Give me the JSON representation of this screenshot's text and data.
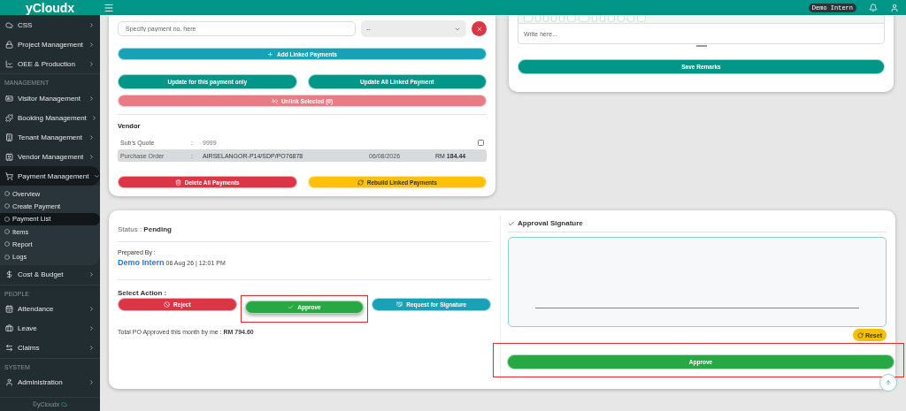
{
  "sidebar": {
    "brand": "yCloudx",
    "items": [
      {
        "kind": "item",
        "label": "CSS"
      },
      {
        "kind": "item",
        "label": "Project Management"
      },
      {
        "kind": "item",
        "label": "OEE & Production"
      },
      {
        "kind": "section",
        "label": "MANAGEMENT"
      },
      {
        "kind": "item",
        "label": "Visitor Management"
      },
      {
        "kind": "item",
        "label": "Booking Management"
      },
      {
        "kind": "item",
        "label": "Tenant Management"
      },
      {
        "kind": "item",
        "label": "Vendor Management"
      },
      {
        "kind": "item",
        "label": "Payment Management",
        "expanded": true,
        "children": [
          {
            "label": "Overview",
            "selected": false
          },
          {
            "label": "Create Payment",
            "selected": false
          },
          {
            "label": "Payment List",
            "selected": true
          },
          {
            "label": "Items",
            "selected": false
          },
          {
            "label": "Report",
            "selected": false
          },
          {
            "label": "Logs",
            "selected": false
          }
        ]
      },
      {
        "kind": "item",
        "label": "Cost & Budget"
      },
      {
        "kind": "section",
        "label": "PEOPLE"
      },
      {
        "kind": "item",
        "label": "Attendance"
      },
      {
        "kind": "item",
        "label": "Leave"
      },
      {
        "kind": "item",
        "label": "Claims"
      },
      {
        "kind": "section",
        "label": "SYSTEM"
      },
      {
        "kind": "item",
        "label": "Administration"
      }
    ],
    "footer": "©yCloudx"
  },
  "topbar": {
    "user_badge": "Demo Intern"
  },
  "payment_link": {
    "placeholder": "Specify payment no. here",
    "select_value": "--",
    "add_button": "Add Linked Payments",
    "update_one_button": "Update for this payment only",
    "update_all_button": "Update All Linked Payment",
    "unlink_button": "Unlink Selected (0)",
    "vendor_title": "Vendor",
    "rows": [
      {
        "kind": "checkable",
        "label": "Sub's Quote",
        "separator": ":",
        "value": "9999",
        "checked": false,
        "selected": false
      },
      {
        "kind": "linked",
        "label": "Purchase Order",
        "separator": ":",
        "value": "AIRSELANGOR-P14/SDP/PO76878",
        "date": "06/08/2026",
        "amount": "RM **184.44**",
        "selected": true
      }
    ],
    "delete_button": "Delete All Payments",
    "rebuild_button": "Rebuild Linked Payments"
  },
  "remarks": {
    "placeholder": "Write here...",
    "save_button": "Save Remarks"
  },
  "approval": {
    "status_label": "Status :",
    "status": "Pending",
    "prepared_label": "Prepared By :",
    "preparer": "Demo Intern",
    "prepared_at": "06 Aug 26 | 12:01 PM",
    "select_action": "Select Action :",
    "actions": [
      {
        "kind": "reject",
        "label": "Reject"
      },
      {
        "kind": "approve",
        "label": "Approve"
      },
      {
        "kind": "request",
        "label": "Request for Signature"
      }
    ],
    "total": "Total PO Approved this month by me : **RM 794.60**",
    "signature_title": "Approval Signature",
    "reset_button": "Reset",
    "approve_button": "Approve"
  }
}
